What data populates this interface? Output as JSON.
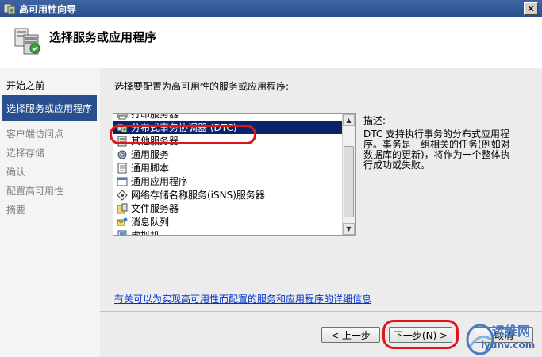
{
  "window": {
    "title": "高可用性向导",
    "close_label": "✕"
  },
  "header": {
    "title": "选择服务或应用程序"
  },
  "nav": {
    "items": [
      {
        "label": "开始之前",
        "state": "done"
      },
      {
        "label": "选择服务或应用程序",
        "state": "current"
      },
      {
        "label": "客户端访问点",
        "state": "pending"
      },
      {
        "label": "选择存储",
        "state": "pending"
      },
      {
        "label": "确认",
        "state": "pending"
      },
      {
        "label": "配置高可用性",
        "state": "pending"
      },
      {
        "label": "摘要",
        "state": "pending"
      }
    ]
  },
  "main": {
    "prompt": "选择要配置为高可用性的服务或应用程序:",
    "list": {
      "items": [
        {
          "label": "打印服务器",
          "icon": "printer-icon"
        },
        {
          "label": "分布式事务协调器 (DTC)",
          "icon": "dtc-icon",
          "selected": true
        },
        {
          "label": "其他服务器",
          "icon": "server-icon"
        },
        {
          "label": "通用服务",
          "icon": "gear-icon"
        },
        {
          "label": "通用脚本",
          "icon": "script-icon"
        },
        {
          "label": "通用应用程序",
          "icon": "application-icon"
        },
        {
          "label": "网络存储名称服务(iSNS)服务器",
          "icon": "isns-icon"
        },
        {
          "label": "文件服务器",
          "icon": "file-server-icon"
        },
        {
          "label": "消息队列",
          "icon": "message-queue-icon"
        },
        {
          "label": "虚拟机",
          "icon": "virtual-machine-icon"
        }
      ]
    },
    "description_label": "描述:",
    "description": "DTC 支持执行事务的分布式应用程序。事务是一组相关的任务(例如对数据库的更新)，将作为一个整体执行成功或失败。",
    "help_link": "有关可以为实现高可用性而配置的服务和应用程序的详细信息"
  },
  "buttons": {
    "back": "< 上一步",
    "next": "下一步(N) >",
    "cancel": "取消"
  },
  "watermark": {
    "text": "运维网",
    "url": "iyunv.com"
  },
  "colors": {
    "titlebar": "#2a4f8e",
    "selection": "#0a246a",
    "annotation": "#e0151c",
    "link": "#0033cc"
  }
}
